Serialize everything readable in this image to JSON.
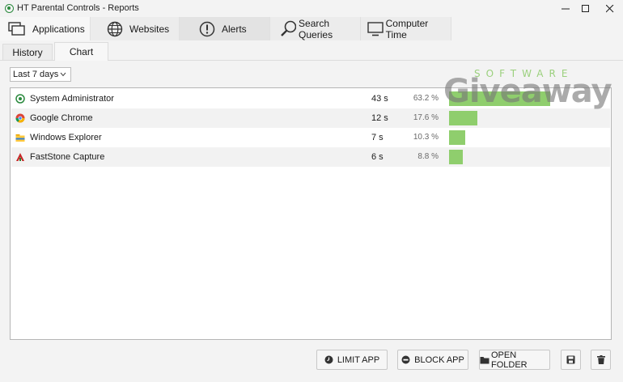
{
  "window": {
    "title": "HT Parental Controls - Reports"
  },
  "tabs": [
    {
      "label": "Applications",
      "icon": "applications-icon"
    },
    {
      "label": "Websites",
      "icon": "globe-icon"
    },
    {
      "label": "Alerts",
      "icon": "alert-icon"
    },
    {
      "label": "Search Queries",
      "icon": "search-icon"
    },
    {
      "label": "Computer Time",
      "icon": "monitor-icon"
    }
  ],
  "subtabs": [
    "History",
    "Chart"
  ],
  "filter": {
    "selected": "Last 7 days"
  },
  "rows": [
    {
      "name": "System Administrator",
      "time": "43 s",
      "percent": "63.2 %",
      "share": 0.632,
      "icon": "ht-app-icon"
    },
    {
      "name": "Google Chrome",
      "time": "12 s",
      "percent": "17.6 %",
      "share": 0.176,
      "icon": "chrome-icon"
    },
    {
      "name": "Windows Explorer",
      "time": "7 s",
      "percent": "10.3 %",
      "share": 0.103,
      "icon": "folder-icon"
    },
    {
      "name": "FastStone Capture",
      "time": "6 s",
      "percent": "8.8 %",
      "share": 0.088,
      "icon": "faststone-icon"
    }
  ],
  "watermark": {
    "top": "SOFTWARE",
    "main": "Giveaway"
  },
  "buttons": {
    "limit": "LIMIT APP",
    "block": "BLOCK APP",
    "open_folder": "OPEN FOLDER"
  },
  "colors": {
    "bar": "#8fce6d",
    "accent": "#2b8a3e"
  }
}
